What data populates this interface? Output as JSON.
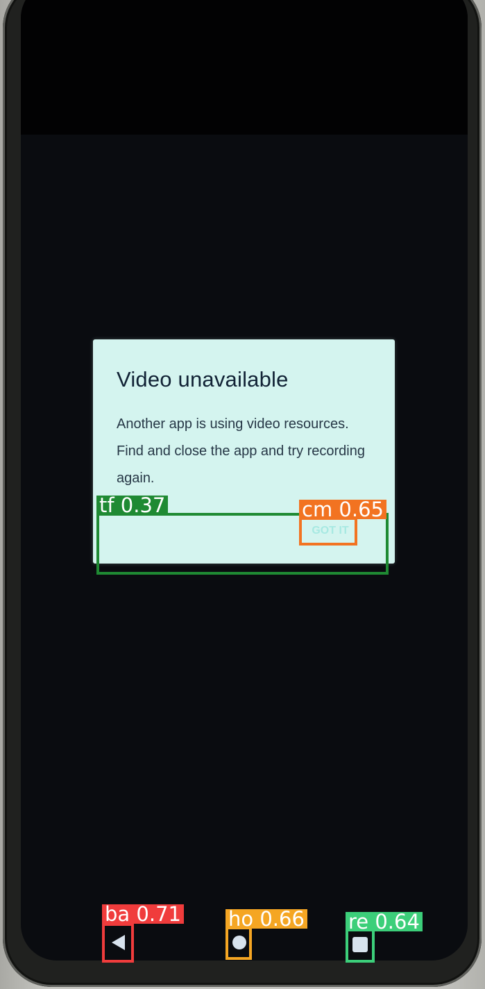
{
  "dialog": {
    "title": "Video unavailable",
    "message": "Another app is using video resources. Find and close the app and try recording again.",
    "button_label": "GOT IT"
  },
  "detections": [
    {
      "label": "tf 0.37",
      "color": "#1f8a33"
    },
    {
      "label": "cm 0.65",
      "color": "#f27321"
    },
    {
      "label": "ba 0.71",
      "color": "#f03c3c"
    },
    {
      "label": "ho 0.66",
      "color": "#f5a623"
    },
    {
      "label": "re 0.64",
      "color": "#3ccf7a"
    }
  ],
  "nav": {
    "back_icon": "back-triangle-icon",
    "home_icon": "home-circle-icon",
    "recents_icon": "recents-square-icon"
  }
}
